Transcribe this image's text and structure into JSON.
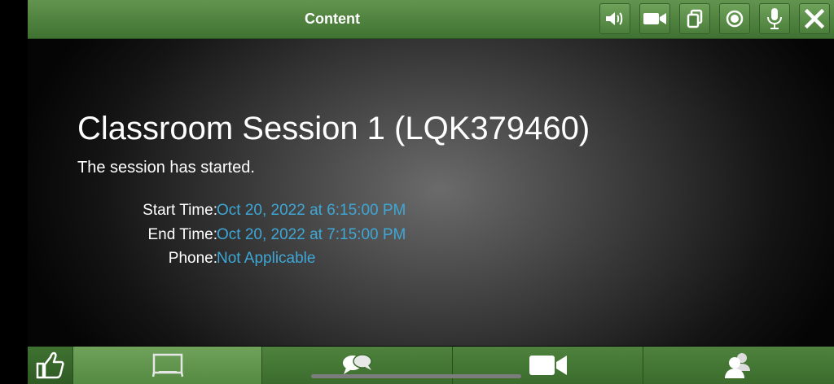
{
  "header": {
    "title": "Content"
  },
  "toolbar": {
    "buttons": [
      {
        "icon": "speaker-icon"
      },
      {
        "icon": "video-camera-icon"
      },
      {
        "icon": "copy-icon"
      },
      {
        "icon": "record-icon"
      },
      {
        "icon": "microphone-icon"
      },
      {
        "icon": "close-icon"
      }
    ]
  },
  "session": {
    "title": "Classroom Session 1 (LQK379460)",
    "status": "The session has started.",
    "start_label": "Start Time:",
    "start_value": "Oct 20, 2022 at 6:15:00 PM",
    "end_label": "End Time:",
    "end_value": "Oct 20, 2022 at 7:15:00 PM",
    "phone_label": "Phone:",
    "phone_value": "Not Applicable"
  },
  "bottom_nav": {
    "items": [
      {
        "icon": "thumbs-up-icon"
      },
      {
        "icon": "whiteboard-icon",
        "active": true
      },
      {
        "icon": "chat-bubbles-icon"
      },
      {
        "icon": "video-camera-icon"
      },
      {
        "icon": "participants-icon"
      }
    ]
  },
  "colors": {
    "bar_green": "#4a7e3a",
    "link_blue": "#3fa7d6",
    "text_white": "#ffffff"
  }
}
